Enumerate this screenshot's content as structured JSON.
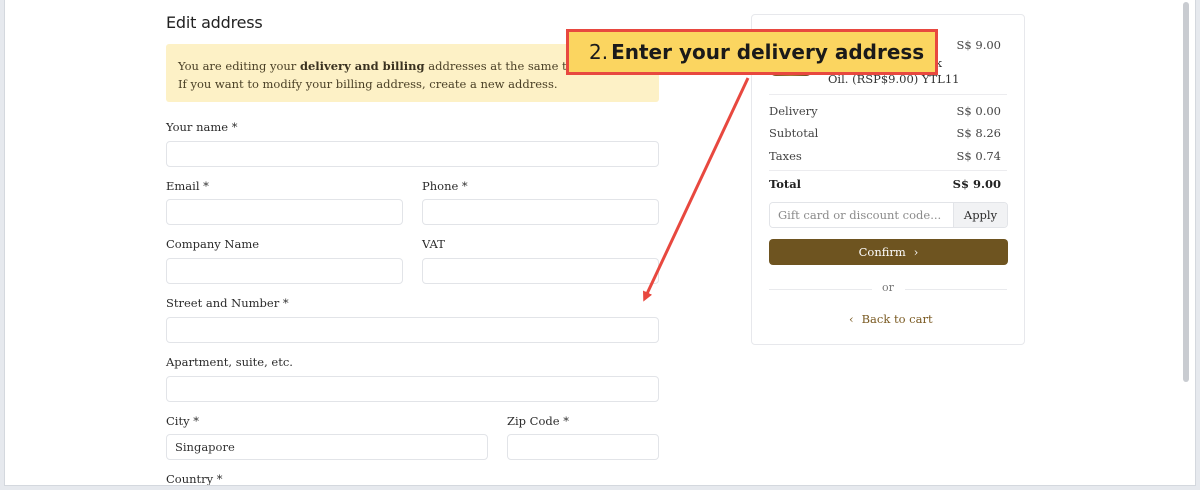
{
  "form": {
    "title": "Edit address",
    "notice": {
      "line1_pre": "You are editing your ",
      "line1_bold": "delivery and billing",
      "line1_post": " addresses at the same time!",
      "line2": "If you want to modify your billing address, create a new address."
    },
    "fields": {
      "name_label": "Your name *",
      "email_label": "Email *",
      "phone_label": "Phone *",
      "company_label": "Company Name",
      "vat_label": "VAT",
      "street_label": "Street and Number *",
      "apartment_label": "Apartment, suite, etc.",
      "city_label": "City *",
      "city_value": "Singapore",
      "zip_label": "Zip Code *",
      "country_label": "Country *"
    }
  },
  "summary": {
    "item_price": "S$ 9.00",
    "item_desc_line1": "k",
    "item_desc_line2": "Oil. (RSP$9.00) YTL11",
    "rows": [
      {
        "label": "Delivery",
        "value": "S$ 0.00"
      },
      {
        "label": "Subtotal",
        "value": "S$ 8.26"
      },
      {
        "label": "Taxes",
        "value": "S$ 0.74"
      }
    ],
    "total_label": "Total",
    "total_value": "S$ 9.00",
    "discount_placeholder": "Gift card or discount code...",
    "apply_label": "Apply",
    "confirm_label": "Confirm",
    "confirm_chevron": "›",
    "or_label": "or",
    "back_chevron": "‹",
    "back_label": "Back to cart"
  },
  "callout": {
    "number": "2.",
    "text": "Enter your delivery address"
  },
  "colors": {
    "accent": "#6e5420",
    "notice_bg": "#fdf1c6",
    "callout_bg": "#fbd560",
    "callout_border": "#e8483f"
  }
}
